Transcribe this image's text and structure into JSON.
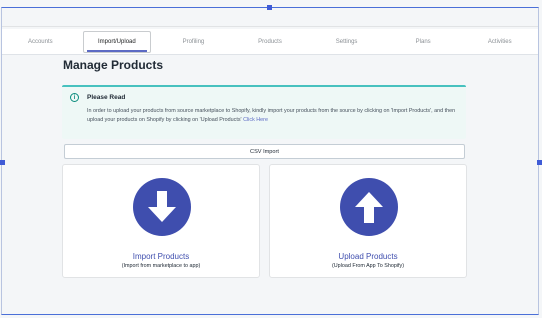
{
  "tabs": [
    {
      "label": "Accounts",
      "active": false
    },
    {
      "label": "Import/Upload",
      "active": true
    },
    {
      "label": "Profiling",
      "active": false
    },
    {
      "label": "Products",
      "active": false
    },
    {
      "label": "Settings",
      "active": false
    },
    {
      "label": "Plans",
      "active": false
    },
    {
      "label": "Activities",
      "active": false
    }
  ],
  "page": {
    "title": "Manage Products"
  },
  "banner": {
    "icon": "info-icon",
    "icon_glyph": "i",
    "title": "Please Read",
    "text": "In order to upload your products from source marketplace to Shopify, kindly import your products from the source by clicking on 'Import Products', and then upload your products on Shopify by clicking on 'Upload Products'",
    "link": "Click Here"
  },
  "csv_button": {
    "label": "CSV Import"
  },
  "cards": {
    "import": {
      "icon": "arrow-down-circle-icon",
      "title": "Import Products",
      "subtitle": "(Import from marketplace to app)"
    },
    "upload": {
      "icon": "arrow-up-circle-icon",
      "title": "Upload Products",
      "subtitle": "(Upload From App To Shopify)"
    }
  },
  "colors": {
    "accent": "#3f4eae",
    "banner_border": "#47c1bf",
    "banner_bg": "#eef8f6",
    "link": "#5c6ac4"
  }
}
